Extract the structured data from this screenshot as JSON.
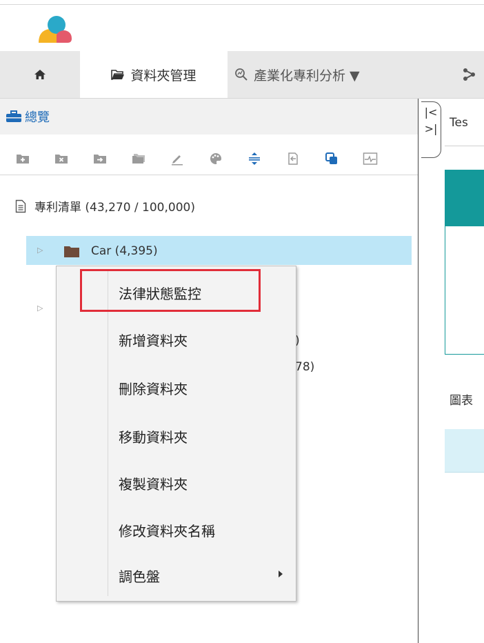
{
  "nav": {
    "tabs": [
      {
        "label": ""
      },
      {
        "label": "資料夾管理"
      },
      {
        "label": "產業化專利分析 ▼"
      },
      {
        "label": ""
      }
    ]
  },
  "sidebar": {
    "overview_label": "總覽",
    "toolbar_icons": [
      "add-folder-icon",
      "delete-folder-icon",
      "move-folder-icon",
      "copy-folder-icon",
      "rename-icon",
      "palette-icon",
      "expand-collapse-icon",
      "export-icon",
      "merge-icon",
      "compare-icon"
    ],
    "tree": {
      "root_label": "專利清單 (43,270 / 100,000)",
      "selected_folder": "Car (4,395)",
      "partial_counts": [
        ")",
        "78)"
      ]
    }
  },
  "context_menu": {
    "items": [
      {
        "label": "法律狀態監控",
        "highlighted": true
      },
      {
        "label": "新增資料夾"
      },
      {
        "label": "刪除資料夾"
      },
      {
        "label": "移動資料夾"
      },
      {
        "label": "複製資料夾"
      },
      {
        "label": "修改資料夾名稱"
      },
      {
        "label": "調色盤",
        "has_submenu": true
      }
    ]
  },
  "right_panel": {
    "tab_label": "Tes",
    "chart_label": "圖表",
    "collapse_left": "|<",
    "collapse_right": ">|"
  },
  "colors": {
    "accent_teal": "#14999a",
    "selection": "#bde6f7",
    "highlight_box": "#e12d39",
    "link_blue": "#1e6bb8"
  }
}
